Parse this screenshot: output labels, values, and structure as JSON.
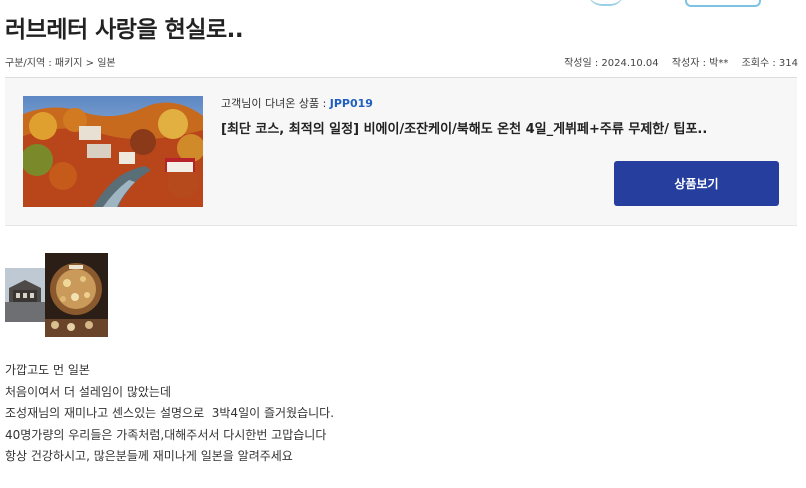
{
  "post": {
    "title": "러브레터 사랑을 현실로..",
    "breadcrumb": "구분/지역 : 패키지 > 일본",
    "date_label": "작성일 : 2024.10.04",
    "author_label": "작성자 : 박**",
    "views_label": "조회수 : 314"
  },
  "product": {
    "visited_label": "고객님이 다녀온 상품 : ",
    "code": "JPP019",
    "name": "[최단 코스, 최적의 일정] 비에이/조잔케이/북해도 온천 4일_게뷔페+주류 무제한/ 팁포..",
    "view_button_label": "상품보기",
    "accent_color": "#263e9e",
    "code_color": "#1f5fbf"
  },
  "review": {
    "lines": [
      "가깝고도 먼 일본",
      "처음이여서 더 설레임이 많았는데",
      "조성재님의 재미나고 센스있는 설명으로  3박4일이 즐거웠습니다.",
      "40명가량의 우리들은 가족처럼,대해주서서 다시한번 고맙습니다",
      "항상 건강하시고, 많은분들께 재미나게 일본을 알려주세요"
    ]
  }
}
